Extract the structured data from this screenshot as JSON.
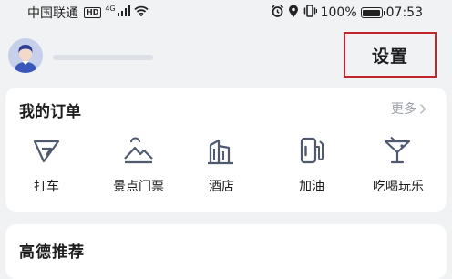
{
  "status_bar": {
    "carrier": "中国联通",
    "hd_badge": "HD",
    "network": "4G",
    "battery_text": "100%",
    "time": "07:53"
  },
  "profile": {
    "settings_label": "设置",
    "highlight_color": "#c0272d"
  },
  "orders": {
    "title": "我的订单",
    "more_label": "更多",
    "items": [
      {
        "label": "打车",
        "icon": "taxi-icon"
      },
      {
        "label": "景点门票",
        "icon": "scenic-ticket-icon"
      },
      {
        "label": "酒店",
        "icon": "hotel-icon"
      },
      {
        "label": "加油",
        "icon": "fuel-pump-icon"
      },
      {
        "label": "吃喝玩乐",
        "icon": "cocktail-icon"
      }
    ]
  },
  "recommend": {
    "title": "高德推荐"
  },
  "colors": {
    "icon_stroke": "#4f5a70",
    "background": "#f1f2f4"
  }
}
